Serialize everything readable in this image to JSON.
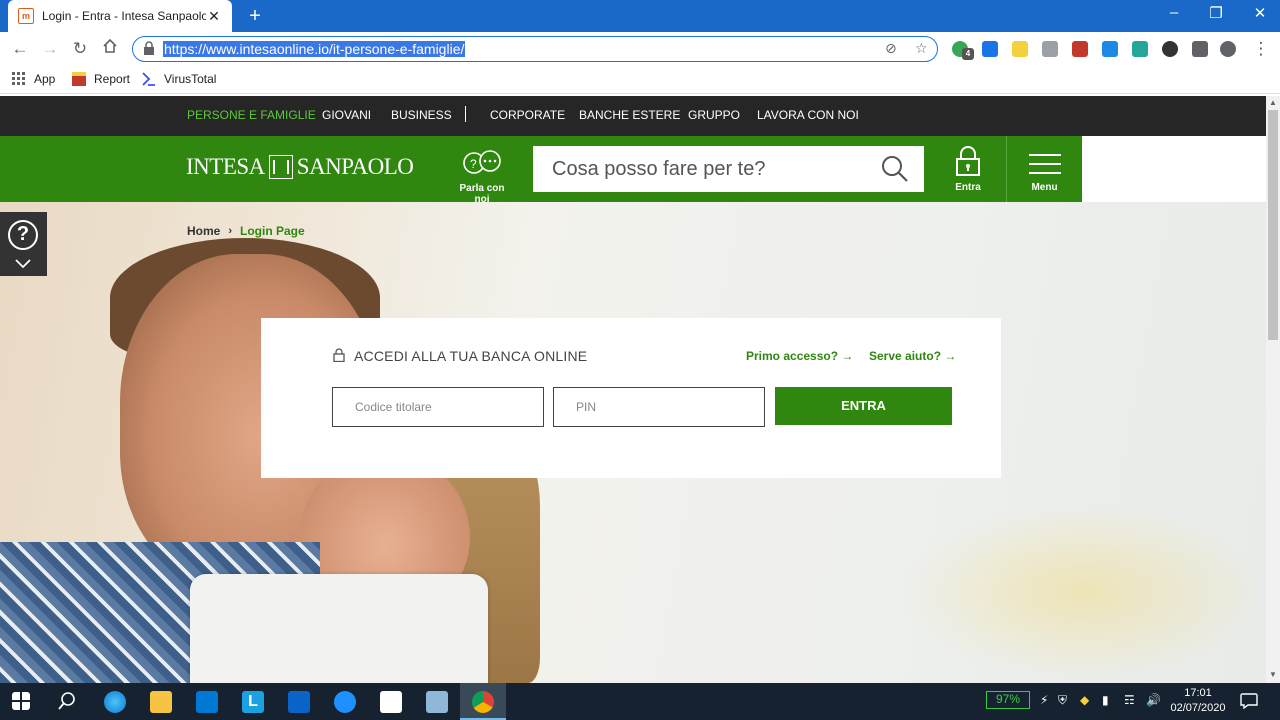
{
  "browser": {
    "tab_title": "Login - Entra - Intesa Sanpaolo",
    "tab_favicon": "m",
    "url": "https://www.intesaonline.io/it-persone-e-famiglie/",
    "bookmarks": [
      "App",
      "Report",
      "VirusTotal"
    ],
    "extension_badge": "4"
  },
  "site": {
    "topnav": [
      "PERSONE E FAMIGLIE",
      "GIOVANI",
      "BUSINESS",
      "CORPORATE",
      "BANCHE ESTERE",
      "GRUPPO",
      "LAVORA CON NOI"
    ],
    "logo_left": "INTESA",
    "logo_right": "SANPAOLO",
    "chat_label": "Parla con noi",
    "search_placeholder": "Cosa posso fare per te?",
    "entra_label": "Entra",
    "menu_label": "Menu",
    "breadcrumb": {
      "home": "Home",
      "current": "Login Page"
    },
    "login": {
      "title": "ACCEDI ALLA TUA BANCA ONLINE",
      "first_access": "Primo accesso? →",
      "help": "Serve aiuto? →",
      "user_placeholder": "Codice titolare",
      "pin_placeholder": "PIN",
      "submit": "ENTRA"
    }
  },
  "taskbar": {
    "battery": "97%",
    "time": "17:01",
    "date": "02/07/2020"
  },
  "colors": {
    "brand_green": "#2f870f",
    "active_nav": "#5ec83b",
    "topnav_bg": "#262626"
  }
}
